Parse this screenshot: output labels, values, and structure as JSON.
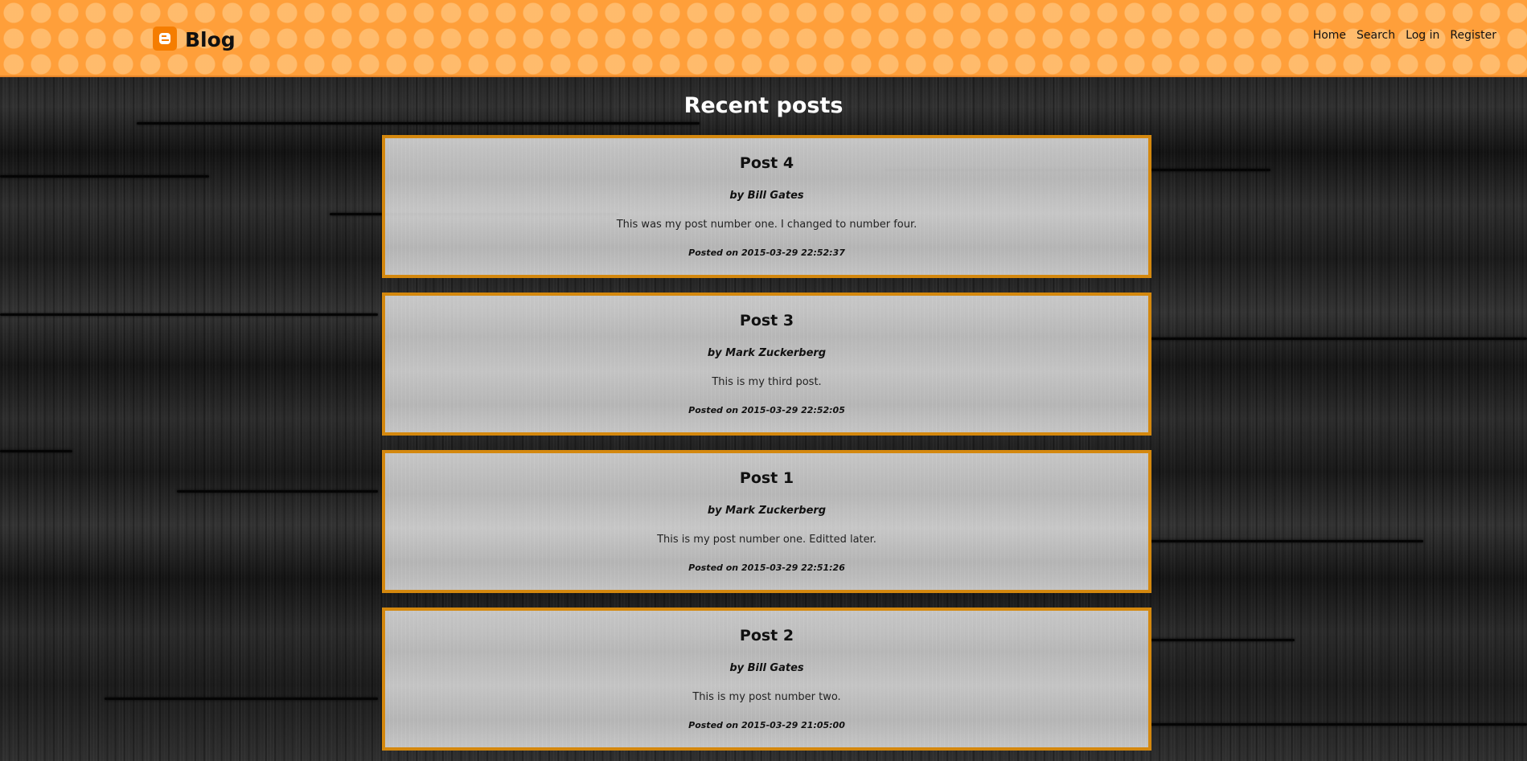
{
  "header": {
    "brand": "Blog",
    "nav": [
      {
        "label": "Home"
      },
      {
        "label": "Search"
      },
      {
        "label": "Log in"
      },
      {
        "label": "Register"
      }
    ]
  },
  "main": {
    "title": "Recent posts",
    "posts": [
      {
        "title": "Post 4",
        "author": "by Bill Gates",
        "body": "This was my post number one. I changed to number four.",
        "date": "Posted on 2015-03-29 22:52:37"
      },
      {
        "title": "Post 3",
        "author": "by Mark Zuckerberg",
        "body": "This is my third post.",
        "date": "Posted on 2015-03-29 22:52:05"
      },
      {
        "title": "Post 1",
        "author": "by Mark Zuckerberg",
        "body": "This is my post number one. Editted later.",
        "date": "Posted on 2015-03-29 22:51:26"
      },
      {
        "title": "Post 2",
        "author": "by Bill Gates",
        "body": "This is my post number two.",
        "date": "Posted on 2015-03-29 21:05:00"
      }
    ]
  },
  "colors": {
    "header": "#ff9f3a",
    "post_border": "#d4880e",
    "logo": "#f57d00"
  },
  "icons": {
    "brand_logo": "blogger-icon"
  }
}
